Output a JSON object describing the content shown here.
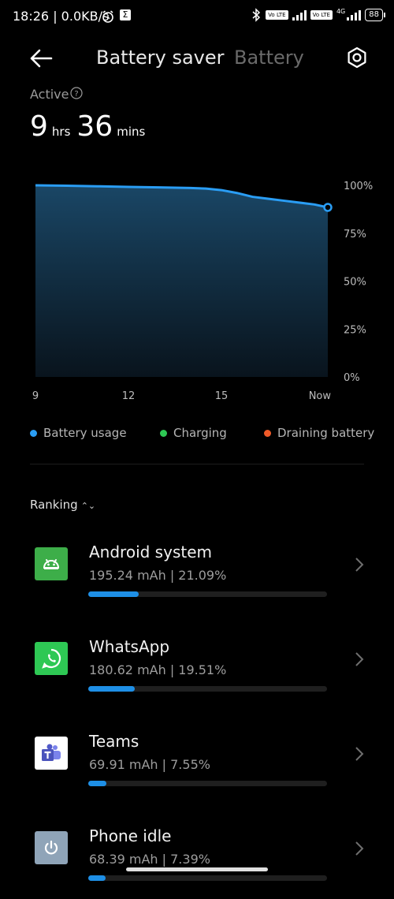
{
  "status_bar": {
    "time": "18:26 | 0.0KB/s",
    "alarm_icon": "alarm-clock-icon",
    "sigma_icon": "sigma-icon",
    "bluetooth_icon": "bluetooth-icon",
    "volte1": "Vo LTE",
    "volte2": "Vo LTE",
    "network": "4G",
    "battery": "88"
  },
  "header": {
    "tab_active": "Battery saver",
    "tab_other": "Battery",
    "back_icon": "back-arrow-icon",
    "settings_icon": "settings-hexagon-icon"
  },
  "active": {
    "label": "Active",
    "hours": "9",
    "hours_unit": "hrs",
    "minutes": "36",
    "minutes_unit": "mins"
  },
  "chart_data": {
    "type": "area",
    "x_ticks": [
      "9",
      "12",
      "15",
      "Now"
    ],
    "y_ticks": [
      "100%",
      "75%",
      "50%",
      "25%",
      "0%"
    ],
    "ylim": [
      0,
      100
    ],
    "xlim": [
      9,
      18.43
    ],
    "series": [
      {
        "name": "Battery usage",
        "x": [
          9,
          10,
          11,
          12,
          13,
          14,
          14.5,
          15,
          15.5,
          16,
          16.5,
          17,
          17.5,
          18,
          18.43
        ],
        "values": [
          100,
          99.8,
          99.5,
          99.2,
          98.9,
          98.6,
          98.3,
          97.5,
          96,
          94,
          93,
          92,
          91,
          90,
          88.5
        ]
      }
    ],
    "line_color": "#2a9df4",
    "grid": false
  },
  "legend": [
    {
      "label": "Battery usage",
      "color": "#2a9df4"
    },
    {
      "label": "Charging",
      "color": "#2ec854"
    },
    {
      "label": "Draining battery",
      "color": "#f05a28"
    }
  ],
  "ranking": {
    "label": "Ranking"
  },
  "apps": [
    {
      "name": "Android system",
      "usage": "195.24 mAh | 21.09%",
      "percent": 21.09,
      "icon": "android-icon",
      "icon_bg": "#3dae49"
    },
    {
      "name": "WhatsApp",
      "usage": "180.62 mAh | 19.51%",
      "percent": 19.51,
      "icon": "whatsapp-icon",
      "icon_bg": "#2ec854"
    },
    {
      "name": "Teams",
      "usage": "69.91 mAh | 7.55%",
      "percent": 7.55,
      "icon": "teams-icon",
      "icon_bg": "#ffffff"
    },
    {
      "name": "Phone idle",
      "usage": "68.39 mAh | 7.39%",
      "percent": 7.39,
      "icon": "power-icon",
      "icon_bg": "#8fa4b8"
    }
  ]
}
